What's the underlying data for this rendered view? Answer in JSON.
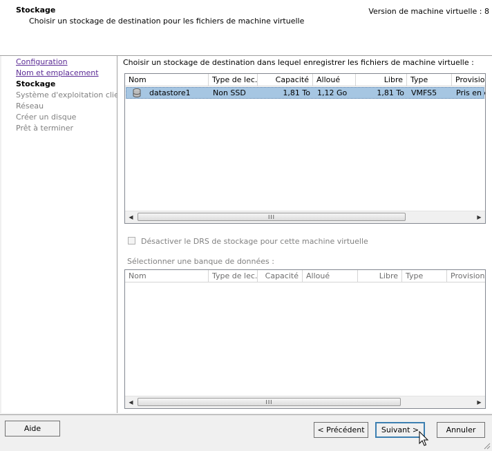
{
  "header": {
    "title": "Stockage",
    "subtitle": "Choisir un stockage de destination pour les fichiers de machine virtuelle",
    "version": "Version de machine virtuelle : 8"
  },
  "nav": {
    "items": [
      {
        "label": "Configuration",
        "state": "done"
      },
      {
        "label": "Nom et emplacement",
        "state": "done"
      },
      {
        "label": "Stockage",
        "state": "current"
      },
      {
        "label": "Système d'exploitation client",
        "state": "future"
      },
      {
        "label": "Réseau",
        "state": "future"
      },
      {
        "label": "Créer un disque",
        "state": "future"
      },
      {
        "label": "Prêt à terminer",
        "state": "future"
      }
    ]
  },
  "main": {
    "instruction": "Choisir un stockage de destination dans lequel enregistrer les fichiers de machine virtuelle :",
    "datastore_table": {
      "columns": [
        "Nom",
        "Type de lec...",
        "Capacité",
        "Alloué",
        "Libre",
        "Type",
        "Provisio"
      ],
      "rows": [
        {
          "name": "datastore1",
          "drive_type": "Non SSD",
          "capacity": "1,81 To",
          "allocated": "1,12 Go",
          "free": "1,81 To",
          "type": "VMFS5",
          "provisioning": "Pris en ch"
        }
      ],
      "scroll_grip": "III"
    },
    "drs_checkbox": {
      "label": "Désactiver le DRS de stockage pour cette machine virtuelle",
      "checked": false
    },
    "select_label": "Sélectionner une banque de données :",
    "cluster_table": {
      "columns": [
        "Nom",
        "Type de lec...",
        "Capacité",
        "Alloué",
        "Libre",
        "Type",
        "Provisionn"
      ],
      "scroll_grip": "III"
    }
  },
  "footer": {
    "help": "Aide",
    "previous": "< Précédent",
    "next": "Suivant >",
    "cancel": "Annuler"
  },
  "icons": {
    "datastore": "database-icon",
    "scroll_left": "chevron-left-icon",
    "scroll_right": "chevron-right-icon",
    "cursor": "mouse-pointer-icon",
    "resize": "resize-grip-icon"
  },
  "colors": {
    "selected_row": "#a6c6e2",
    "link_visited": "#5b2b95",
    "disabled_text": "#808080"
  }
}
